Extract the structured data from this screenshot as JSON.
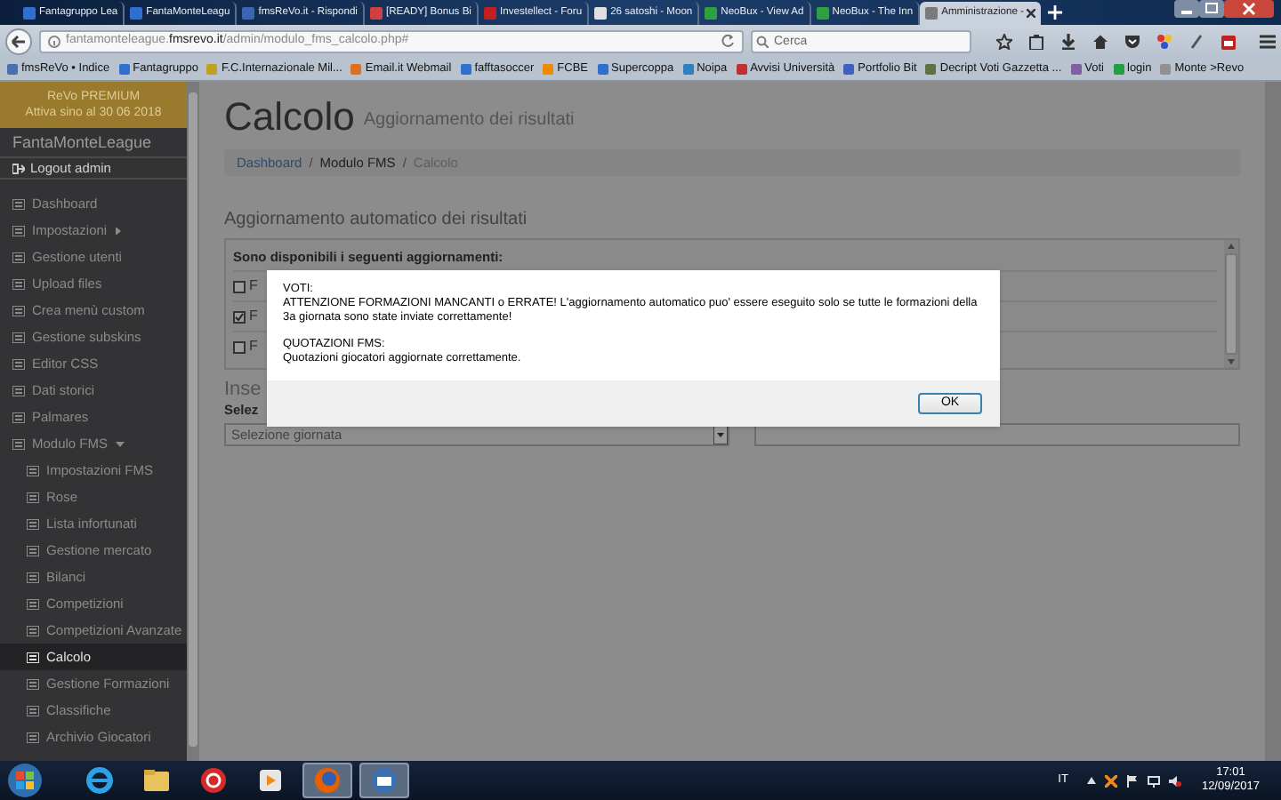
{
  "browser": {
    "tabs": [
      {
        "title": "Fantagruppo Lea",
        "selected": false,
        "color": "#2f6fd0"
      },
      {
        "title": "FantaMonteLeagu",
        "selected": false,
        "color": "#2f6fd0"
      },
      {
        "title": "fmsReVo.it - Rispondi",
        "selected": false,
        "color": "#3a66b0"
      },
      {
        "title": "[READY] Bonus Bi",
        "selected": false,
        "color": "#d04040"
      },
      {
        "title": "Investellect - Foru",
        "selected": false,
        "color": "#c02020"
      },
      {
        "title": "26 satoshi - Moon",
        "selected": false,
        "color": "#e0e0e0"
      },
      {
        "title": "NeoBux - View Ad",
        "selected": false,
        "color": "#2fa040"
      },
      {
        "title": "NeoBux - The Inn",
        "selected": false,
        "color": "#2fa040"
      },
      {
        "title": "Amministrazione -",
        "selected": true,
        "color": "#7a7a7a"
      }
    ],
    "url": "fantamonteleague.**fmsrevo.it**/admin/modulo_fms_calcolo.php#",
    "search_placeholder": "Cerca",
    "bookmarks": [
      {
        "label": "fmsReVo • Indice",
        "color": "#4a6fb0"
      },
      {
        "label": "Fantagruppo",
        "color": "#2f6fd0"
      },
      {
        "label": "F.C.Internazionale Mil...",
        "color": "#c0a020"
      },
      {
        "label": "Email.it Webmail",
        "color": "#e07020"
      },
      {
        "label": "fafftasoccer",
        "color": "#2f6fd0"
      },
      {
        "label": "FCBE",
        "color": "#f08a00"
      },
      {
        "label": "Supercoppa",
        "color": "#2f6fd0"
      },
      {
        "label": "Noipa",
        "color": "#3080c0"
      },
      {
        "label": "Avvisi Università",
        "color": "#c03030"
      },
      {
        "label": "Portfolio Bit",
        "color": "#4060c0"
      },
      {
        "label": "Decript Voti Gazzetta ...",
        "color": "#607040"
      },
      {
        "label": "Voti",
        "color": "#8060a0"
      },
      {
        "label": "login",
        "color": "#20a040"
      },
      {
        "label": "Monte >Revo",
        "color": "#909090"
      }
    ]
  },
  "sidebar": {
    "plan_title": "ReVo PREMIUM",
    "plan_subtitle": "Attiva sino al 30 06 2018",
    "site_name": "FantaMonteLeague",
    "logout": "Logout admin",
    "items": [
      {
        "label": "Dashboard",
        "selected": false
      },
      {
        "label": "Impostazioni",
        "selected": false,
        "expanded": false
      },
      {
        "label": "Gestione utenti",
        "selected": false
      },
      {
        "label": "Upload files",
        "selected": false
      },
      {
        "label": "Crea menù custom",
        "selected": false
      },
      {
        "label": "Gestione subskins",
        "selected": false
      },
      {
        "label": "Editor CSS",
        "selected": false
      },
      {
        "label": "Dati storici",
        "selected": false
      },
      {
        "label": "Palmares",
        "selected": false
      },
      {
        "label": "Modulo FMS",
        "selected": false,
        "expanded": true,
        "children": [
          {
            "label": "Impostazioni FMS",
            "selected": false
          },
          {
            "label": "Rose",
            "selected": false
          },
          {
            "label": "Lista infortunati",
            "selected": false
          },
          {
            "label": "Gestione mercato",
            "selected": false
          },
          {
            "label": "Bilanci",
            "selected": false
          },
          {
            "label": "Competizioni",
            "selected": false
          },
          {
            "label": "Competizioni Avanzate",
            "selected": false
          },
          {
            "label": "Calcolo",
            "selected": true
          },
          {
            "label": "Gestione Formazioni",
            "selected": false
          },
          {
            "label": "Classifiche",
            "selected": false
          },
          {
            "label": "Archivio Giocatori",
            "selected": false
          }
        ]
      }
    ]
  },
  "page": {
    "title": "Calcolo",
    "subtitle": "Aggiornamento dei risultati",
    "breadcrumb_separator": "/",
    "breadcrumb": [
      {
        "label": "Dashboard",
        "kind": "link"
      },
      {
        "label": "Modulo FMS",
        "kind": "text"
      },
      {
        "label": "Calcolo",
        "kind": "current"
      }
    ],
    "section_title": "Aggiornamento automatico dei risultati",
    "panel_heading": "Sono disponibili i seguenti aggiornamenti:",
    "updates": [
      {
        "label": "F",
        "checked": false
      },
      {
        "label": "F",
        "checked": true
      },
      {
        "label": "F",
        "checked": false
      }
    ],
    "section2_title": "Inse",
    "select_label": "Selez",
    "round_select": "Selezione giornata"
  },
  "dialog": {
    "blocks": [
      [
        "VOTI:",
        "ATTENZIONE FORMAZIONI MANCANTI o ERRATE! L'aggiornamento automatico puo' essere eseguito solo se tutte le formazioni della 3a giornata sono state inviate correttamente!"
      ],
      [
        "QUOTAZIONI FMS:",
        "Quotazioni giocatori aggiornate correttamente."
      ]
    ],
    "button": "OK"
  },
  "taskbar": {
    "apps": [
      {
        "kind": "ie",
        "active": false
      },
      {
        "kind": "folder",
        "active": false
      },
      {
        "kind": "calendar",
        "active": false
      },
      {
        "kind": "player",
        "active": false
      },
      {
        "kind": "firefox",
        "active": true
      },
      {
        "kind": "mail",
        "active": true
      }
    ],
    "language": "IT",
    "time": "17:01",
    "date": "12/09/2017"
  }
}
